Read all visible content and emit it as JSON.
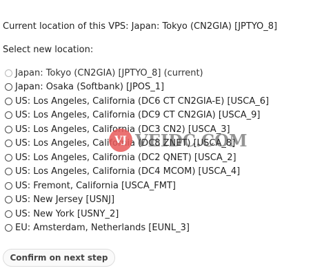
{
  "current_location": {
    "text": "Current location of this VPS: Japan: Tokyo (CN2GIA) [JPTYO_8]"
  },
  "select_prompt": {
    "text": "Select new location:"
  },
  "locations": [
    {
      "label": "Japan: Tokyo (CN2GIA) [JPTYO_8] (current)",
      "disabled": true
    },
    {
      "label": "Japan: Osaka (Softbank) [JPOS_1]",
      "disabled": false
    },
    {
      "label": "US: Los Angeles, California (DC6 CT CN2GIA-E) [USCA_6]",
      "disabled": false
    },
    {
      "label": "US: Los Angeles, California (DC9 CT CN2GIA) [USCA_9]",
      "disabled": false
    },
    {
      "label": "US: Los Angeles, California (DC3 CN2) [USCA_3]",
      "disabled": false
    },
    {
      "label": "US: Los Angeles, California (DC8 ZNET) [USCA_8]",
      "disabled": false
    },
    {
      "label": "US: Los Angeles, California (DC2 QNET) [USCA_2]",
      "disabled": false
    },
    {
      "label": "US: Los Angeles, California (DC4 MCOM) [USCA_4]",
      "disabled": false
    },
    {
      "label": "US: Fremont, California [USCA_FMT]",
      "disabled": false
    },
    {
      "label": "US: New Jersey [USNJ]",
      "disabled": false
    },
    {
      "label": "US: New York [USNY_2]",
      "disabled": false
    },
    {
      "label": "EU: Amsterdam, Netherlands [EUNL_3]",
      "disabled": false
    }
  ],
  "confirm_button": {
    "label": "Confirm on next step"
  },
  "watermark": {
    "seal": "VJ",
    "text": "VEIDC.COM"
  }
}
